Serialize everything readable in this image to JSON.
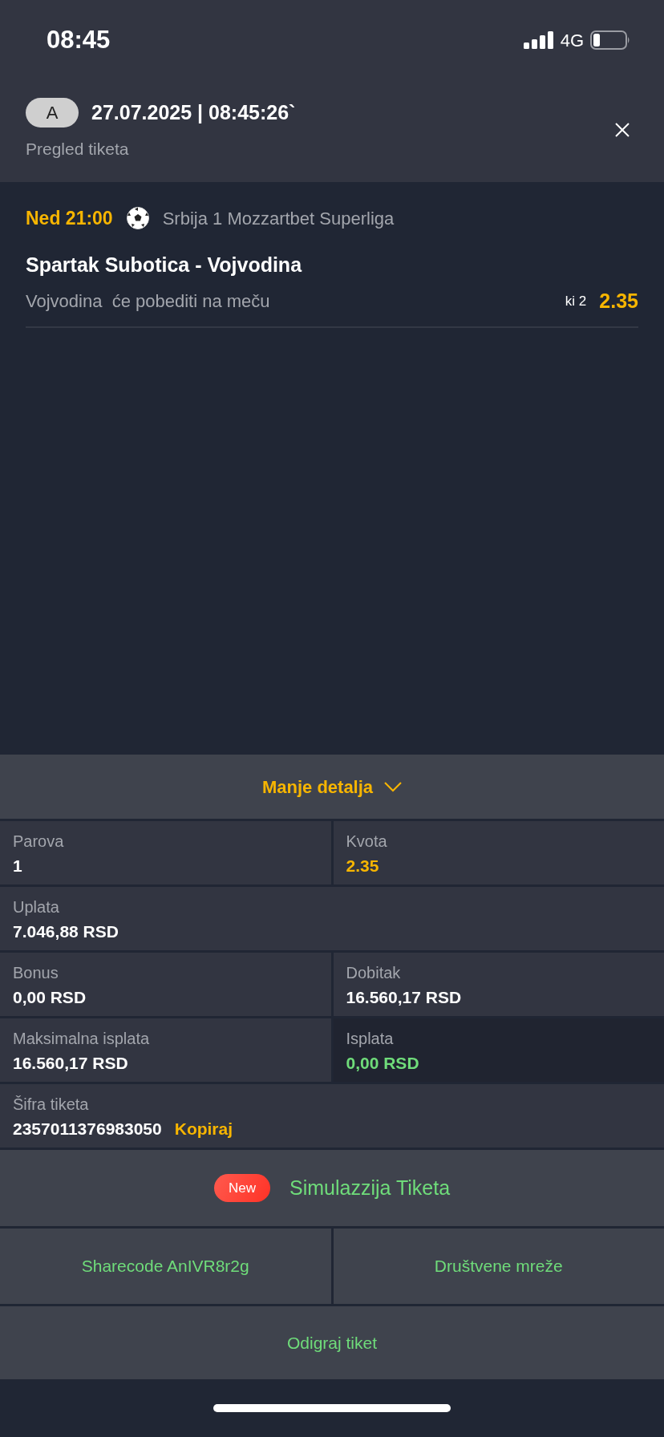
{
  "status_bar": {
    "time": "08:45",
    "network": "4G"
  },
  "header": {
    "badge": "A",
    "datetime": "27.07.2025 | 08:45:26`",
    "subtitle": "Pregled tiketa"
  },
  "match": {
    "time": "Ned 21:00",
    "league": "Srbija 1 Mozzartbet Superliga",
    "teams": "Spartak Subotica - Vojvodina",
    "pick": "Vojvodina  će pobediti na meču",
    "market": "ki 2",
    "odds": "2.35"
  },
  "details_toggle": {
    "label": "Manje detalja",
    "expanded": true
  },
  "details": [
    [
      {
        "label": "Parova",
        "value": "1",
        "kind": "plain",
        "highlighted": false
      },
      {
        "label": "Kvota",
        "value": "2.35",
        "kind": "accent",
        "highlighted": false
      }
    ],
    [
      {
        "label": "Uplata",
        "value": "7.046,88 RSD",
        "kind": "plain",
        "highlighted": false
      }
    ],
    [
      {
        "label": "Bonus",
        "value": "0,00 RSD",
        "kind": "plain",
        "highlighted": false
      },
      {
        "label": "Dobitak",
        "value": "16.560,17 RSD",
        "kind": "plain",
        "highlighted": false
      }
    ],
    [
      {
        "label": "Maksimalna isplata",
        "value": "16.560,17 RSD",
        "kind": "plain",
        "highlighted": false
      },
      {
        "label": "Isplata",
        "value": "0,00 RSD",
        "kind": "success",
        "highlighted": true
      }
    ]
  ],
  "ticket_code": {
    "label": "Šifra tiketa",
    "value": "2357011376983050",
    "action": "Kopiraj"
  },
  "simulation": {
    "badge": "New",
    "label": "Simulazzija Tiketa"
  },
  "actions": [
    "Sharecode AnIVR8r2g",
    "Društvene mreže"
  ],
  "play_button": "Odigraj tiket"
}
